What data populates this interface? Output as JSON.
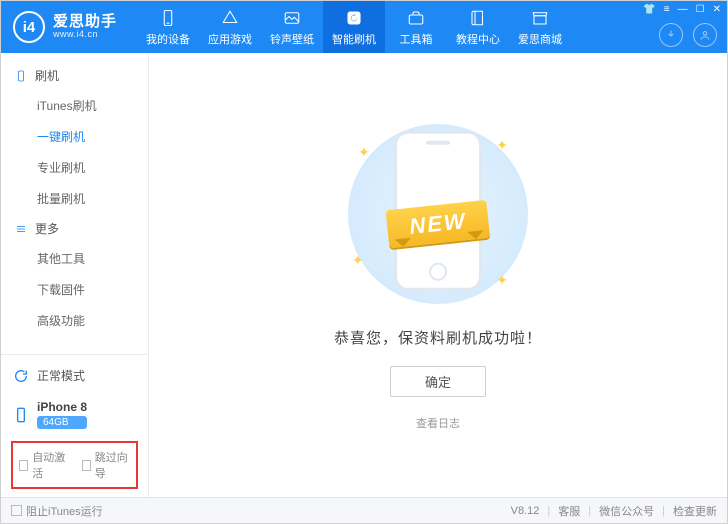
{
  "brand": {
    "name": "爱思助手",
    "url": "www.i4.cn",
    "logo_text": "i4"
  },
  "nav": {
    "items": [
      {
        "label": "我的设备"
      },
      {
        "label": "应用游戏"
      },
      {
        "label": "铃声壁纸"
      },
      {
        "label": "智能刷机"
      },
      {
        "label": "工具箱"
      },
      {
        "label": "教程中心"
      },
      {
        "label": "爱思商城"
      }
    ],
    "active_index": 3
  },
  "sidebar": {
    "groups": [
      {
        "title": "刷机",
        "items": [
          "iTunes刷机",
          "一键刷机",
          "专业刷机",
          "批量刷机"
        ],
        "active_index": 1
      },
      {
        "title": "更多",
        "items": [
          "其他工具",
          "下载固件",
          "高级功能"
        ],
        "active_index": -1
      }
    ],
    "mode_label": "正常模式",
    "device_name": "iPhone 8",
    "device_storage": "64GB",
    "checkbox1": "自动激活",
    "checkbox2": "跳过向导"
  },
  "main": {
    "ribbon_text": "NEW",
    "message": "恭喜您，保资料刷机成功啦！",
    "ok_button": "确定",
    "log_link": "查看日志"
  },
  "footer": {
    "block_itunes": "阻止iTunes运行",
    "version": "V8.12",
    "links": [
      "客服",
      "微信公众号",
      "检查更新"
    ]
  }
}
